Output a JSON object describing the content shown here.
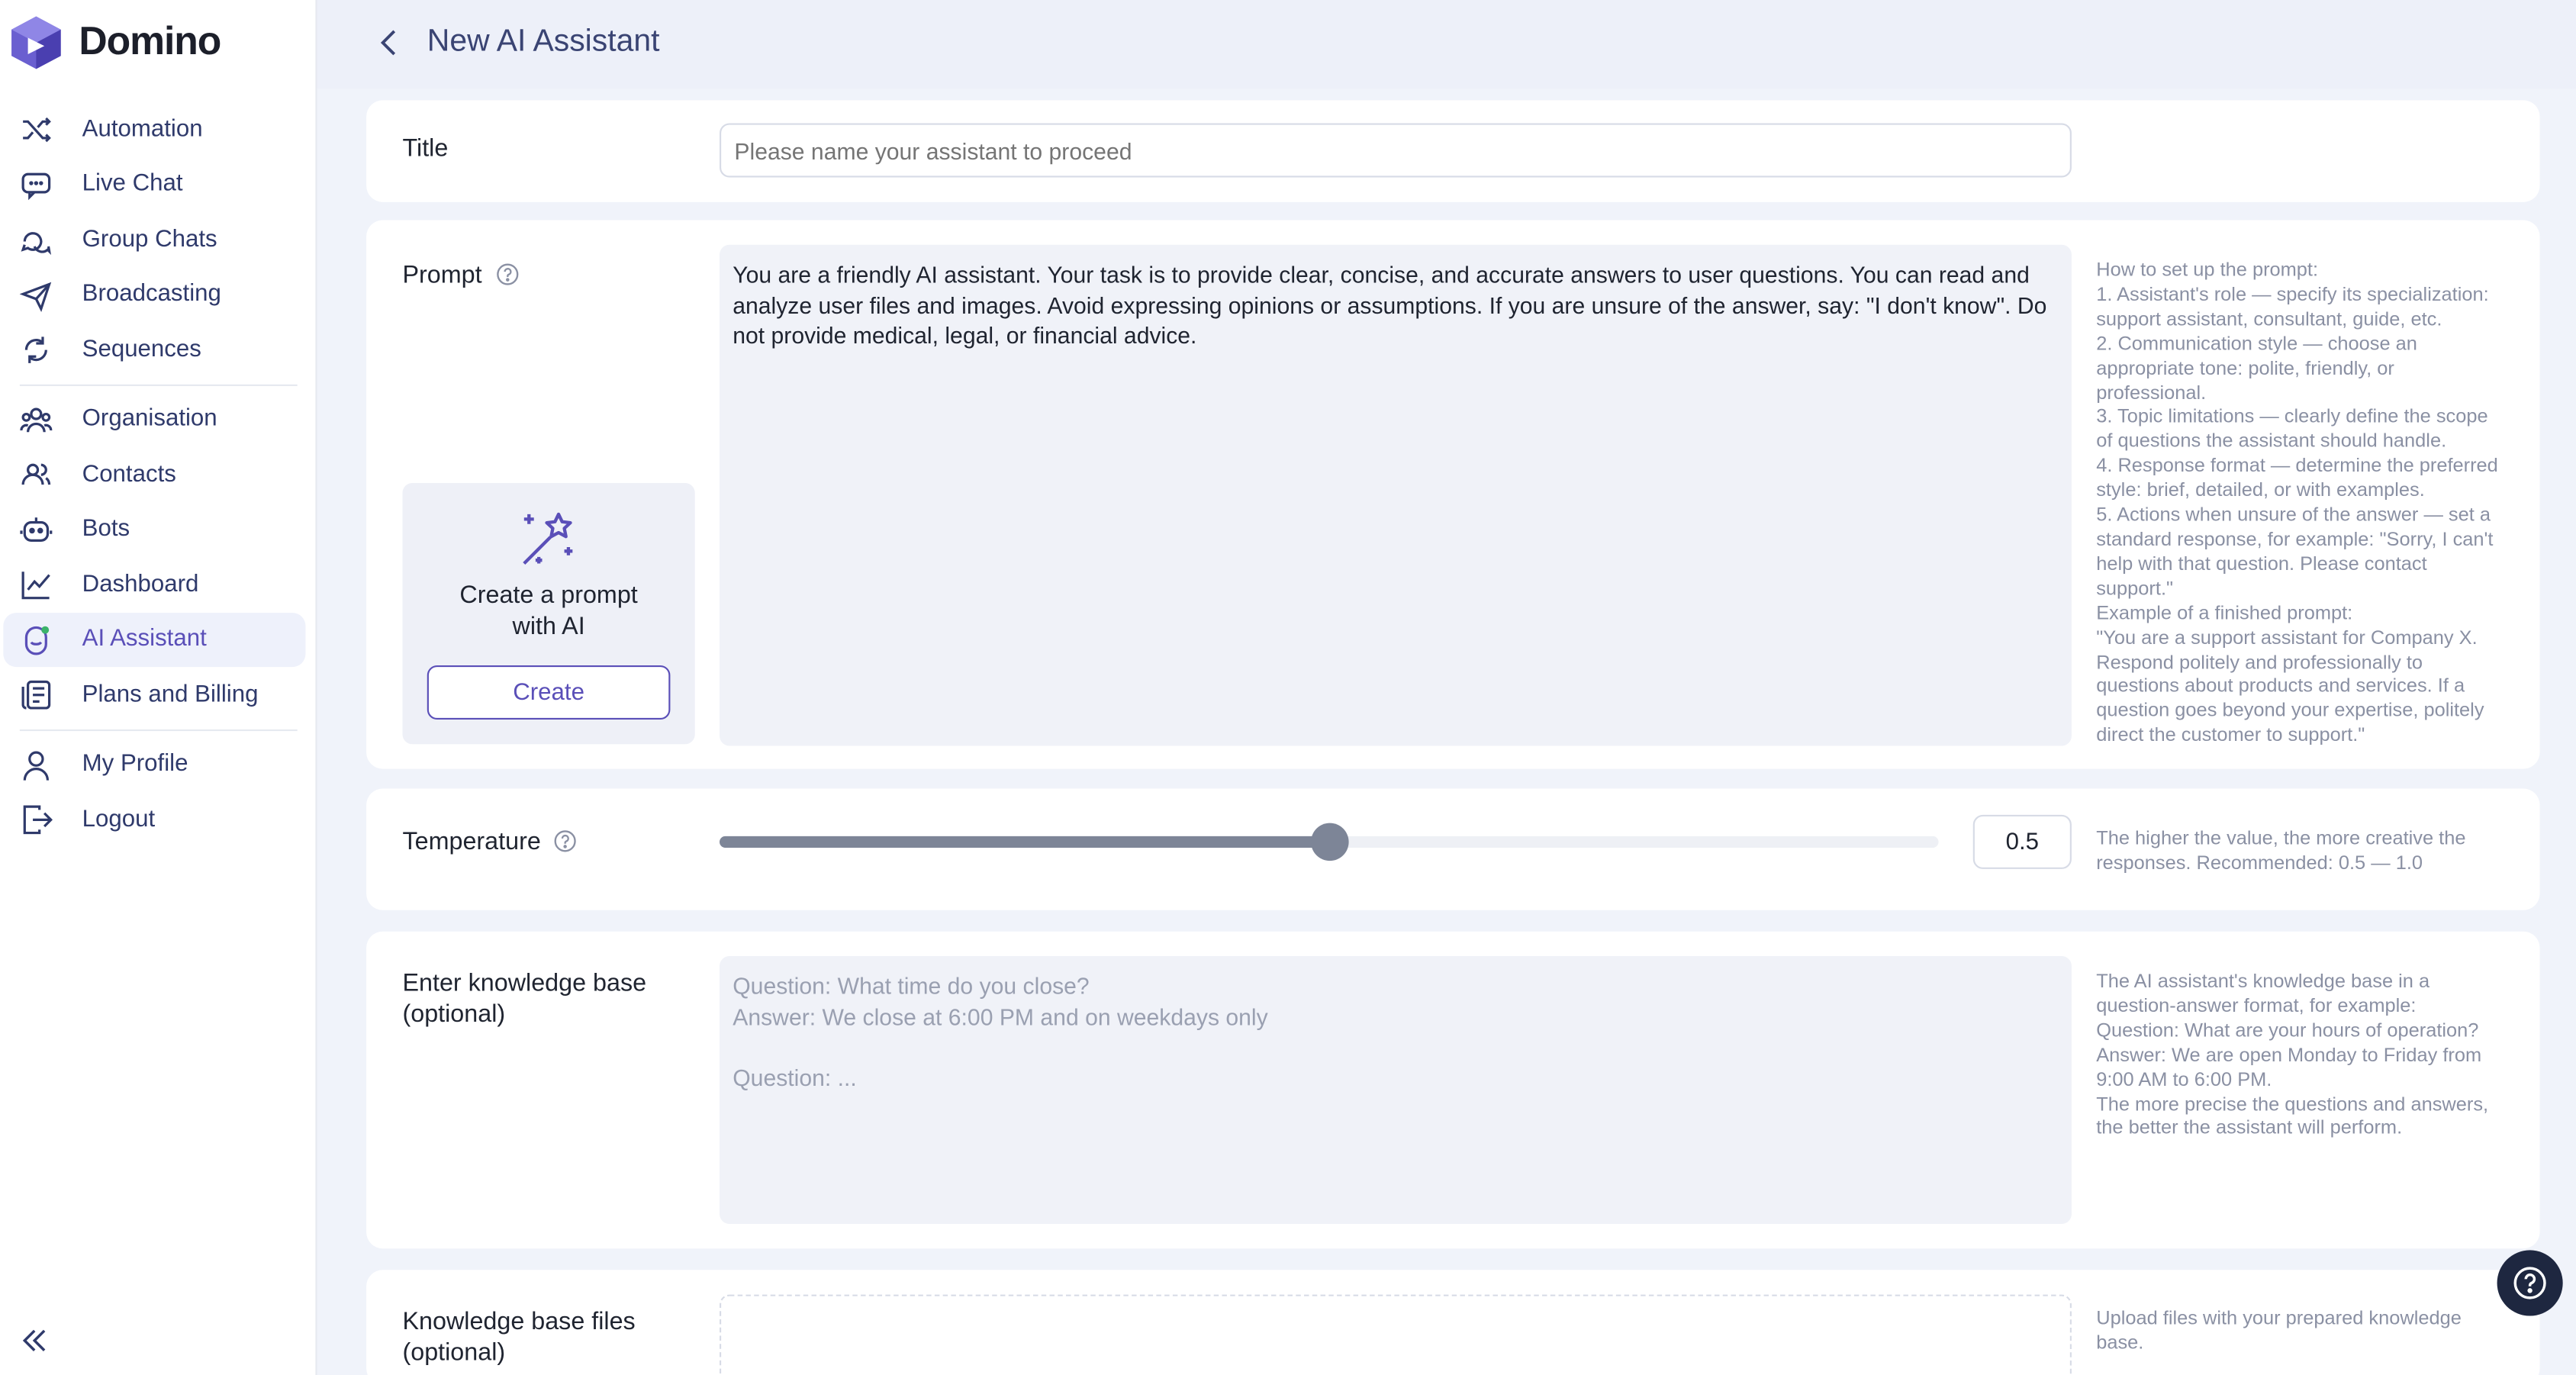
{
  "app": {
    "name": "Domino"
  },
  "colors": {
    "accent": "#5a4fb8",
    "nav_text": "#2f3a6b",
    "fab": "#1e2740"
  },
  "sidebar": {
    "items": [
      {
        "label": "Automation",
        "icon": "shuffle-icon"
      },
      {
        "label": "Live Chat",
        "icon": "chat-icon"
      },
      {
        "label": "Group Chats",
        "icon": "group-chat-icon"
      },
      {
        "label": "Broadcasting",
        "icon": "send-icon"
      },
      {
        "label": "Sequences",
        "icon": "refresh-icon"
      },
      {
        "label": "Organisation",
        "icon": "organisation-icon"
      },
      {
        "label": "Contacts",
        "icon": "contacts-icon"
      },
      {
        "label": "Bots",
        "icon": "bot-icon"
      },
      {
        "label": "Dashboard",
        "icon": "chart-icon"
      },
      {
        "label": "AI Assistant",
        "icon": "ai-assistant-icon",
        "active": true
      },
      {
        "label": "Plans and Billing",
        "icon": "billing-icon"
      },
      {
        "label": "My Profile",
        "icon": "user-icon"
      },
      {
        "label": "Logout",
        "icon": "logout-icon"
      }
    ]
  },
  "header": {
    "title": "New AI Assistant"
  },
  "title_field": {
    "label": "Title",
    "placeholder": "Please name your assistant to proceed"
  },
  "prompt": {
    "label": "Prompt",
    "text": "You are a friendly AI assistant. Your task is to provide clear, concise, and accurate answers to user questions. You can read and analyze user files and images. Avoid expressing opinions or assumptions. If you are unsure of the answer, say: \"I don't know\". Do not provide medical, legal, or financial advice.",
    "ai_box": {
      "text": "Create a prompt with AI",
      "button": "Create"
    },
    "hint": [
      "How to set up the prompt:",
      "1. Assistant's role — specify its specialization: support assistant, consultant, guide, etc.",
      "2. Communication style — choose an appropriate tone: polite, friendly, or professional.",
      "3. Topic limitations — clearly define the scope of questions the assistant should handle.",
      "4. Response format — determine the preferred style: brief, detailed, or with examples.",
      "5. Actions when unsure of the answer — set a standard response, for example: \"Sorry, I can't help with that question. Please contact support.\"",
      "Example of a finished prompt:",
      "\"You are a support assistant for Company X. Respond politely and professionally to questions about products and services. If a question goes beyond your expertise, politely direct the customer to support.\""
    ]
  },
  "temperature": {
    "label": "Temperature",
    "value": "0.5",
    "fraction": 0.5,
    "hint": "The higher the value, the more creative the responses. Recommended: 0.5 — 1.0"
  },
  "knowledge_base": {
    "label": "Enter knowledge base (optional)",
    "placeholder": "Question: What time do you close?\nAnswer: We close at 6:00 PM and on weekdays only\n\nQuestion: ...",
    "hint": [
      "The AI assistant's knowledge base in a question-answer format, for example:",
      "Question: What are your hours of operation?",
      "Answer: We are open Monday to Friday from 9:00 AM to 6:00 PM.",
      "The more precise the questions and answers, the better the assistant will perform."
    ]
  },
  "kb_files": {
    "label": "Knowledge base files (optional)",
    "hint": "Upload files with your prepared knowledge base."
  }
}
